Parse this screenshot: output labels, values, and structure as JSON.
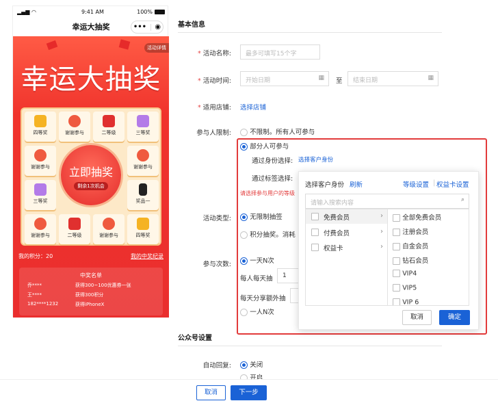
{
  "phone": {
    "status_time": "9:41 AM",
    "status_battery": "100%",
    "nav_title": "幸运大抽奖",
    "hero_title": "幸运大抽奖",
    "rules_tag": "活动详情",
    "cells": [
      {
        "label": "四等奖",
        "color": "#f5b323"
      },
      {
        "label": "谢谢参与",
        "color": "#ef5a3f"
      },
      {
        "label": "二等级",
        "color": "#e0302f"
      },
      {
        "label": "三等奖",
        "color": "#b37be8"
      },
      {
        "label": "谢谢参与",
        "color": "#ef5a3f"
      },
      {
        "label": "谢谢参与",
        "color": "#ef5a3f"
      },
      {
        "label": "三等奖",
        "color": "#b37be8"
      },
      {
        "label": "奖品一",
        "color": "#222222"
      },
      {
        "label": "谢谢参与",
        "color": "#ef5a3f"
      },
      {
        "label": "二等级",
        "color": "#e0302f"
      },
      {
        "label": "谢谢参与",
        "color": "#ef5a3f"
      },
      {
        "label": "四等奖",
        "color": "#f5b323"
      }
    ],
    "go_title": "立即抽奖",
    "go_sub": "剩余1次机会",
    "points": "我的积分：20",
    "my_wins": "我的中奖纪录",
    "winners_title": "中奖名单",
    "winners": [
      {
        "name": "乔****",
        "prize": "获得300~100优惠券一张"
      },
      {
        "name": "王****",
        "prize": "获得300积分"
      },
      {
        "name": "182****1232",
        "prize": "获得iPhoneX"
      }
    ]
  },
  "form": {
    "basic_title": "基本信息",
    "name_label": "活动名称:",
    "name_placeholder": "最多可填写15个字",
    "time_label": "活动时间:",
    "start_placeholder": "开始日期",
    "to": "至",
    "end_placeholder": "结束日期",
    "store_label": "适用店铺:",
    "store_link": "选择店铺",
    "participant_label": "参与人限制:",
    "p_opt1": "不限制。所有人可参与",
    "p_opt2": "部分人可参与",
    "identity_label": "通过身份选择:",
    "identity_link": "选择客户身份",
    "tag_label": "通过标签选择:",
    "warning": "请选择参与用户的等级",
    "type_label": "活动类型:",
    "type_opt1": "无限制抽签",
    "type_opt2": "积分抽奖。消耗",
    "count_label": "参与次数:",
    "count_opt1": "一天N次",
    "daily_label": "每人每天抽",
    "daily_value": "1",
    "share_label": "每天分享额外抽",
    "count_opt2": "一人N次",
    "wechat_title": "公众号设置",
    "reply_label": "自动回复:",
    "reply_opt1": "关闭",
    "reply_opt2": "开启"
  },
  "popup": {
    "title": "选择客户身份",
    "refresh": "刷新",
    "level_settings": "等级设置",
    "card_settings": "权益卡设置",
    "search_placeholder": "请输入搜索内容",
    "left_items": [
      "免费会员",
      "付费会员",
      "权益卡"
    ],
    "right_items": [
      "全部免费会员",
      "注册会员",
      "白金会员",
      "钻石会员",
      "VIP4",
      "VIP5",
      "VIP 6"
    ],
    "cancel": "取消",
    "confirm": "确定"
  },
  "footer": {
    "cancel": "取消",
    "next": "下一步"
  },
  "colors": {
    "primary": "#1a62d6",
    "danger": "#e23a3a",
    "hero": "#ea2e2e"
  }
}
